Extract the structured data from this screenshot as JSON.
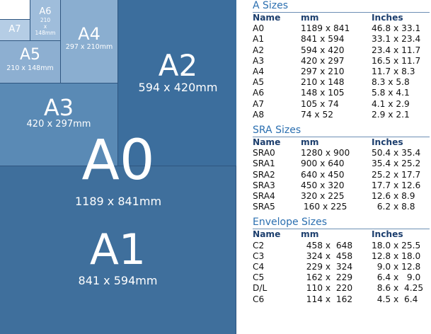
{
  "diagram": {
    "blocks": [
      {
        "id": "a0",
        "name": "A0",
        "dims": "1189 x 841mm"
      },
      {
        "id": "a1",
        "name": "A1",
        "dims": "841 x 594mm"
      },
      {
        "id": "a2",
        "name": "A2",
        "dims": "594 x 420mm"
      },
      {
        "id": "a3",
        "name": "A3",
        "dims": "420 x 297mm"
      },
      {
        "id": "a4",
        "name": "A4",
        "dims": "297 x 210mm"
      },
      {
        "id": "a5",
        "name": "A5",
        "dims": "210 x 148mm"
      },
      {
        "id": "a6",
        "name": "A6",
        "dims_lines": [
          "210",
          "x",
          "148mm"
        ]
      },
      {
        "id": "a7",
        "name": "A7"
      },
      {
        "id": "a8"
      }
    ],
    "colors": {
      "a0": "#3f6f9c",
      "a1": "#3f6f9c",
      "a2": "#3c6e9d",
      "a3": "#5a8ab5",
      "a4": "#8aaed0",
      "a5": "#8dafd1",
      "a6": "#9fbddb",
      "a7": "#b5cde5",
      "a8": "#ffffff",
      "border": "#2f5680"
    }
  },
  "tables": [
    {
      "title": "A Sizes",
      "headers": [
        "Name",
        "mm",
        "Inches"
      ],
      "rows": [
        [
          "A0",
          "1189 x 841",
          "46.8 x 33.1"
        ],
        [
          "A1",
          "841 x 594",
          "33.1 x 23.4"
        ],
        [
          "A2",
          "594 x 420",
          "23.4 x 11.7"
        ],
        [
          "A3",
          "420 x 297",
          "16.5 x 11.7"
        ],
        [
          "A4",
          "297 x 210",
          "11.7 x 8.3"
        ],
        [
          "A5",
          "210 x 148",
          "8.3 x 5.8"
        ],
        [
          "A6",
          "148 x 105",
          "5.8 x 4.1"
        ],
        [
          "A7",
          "105 x 74",
          "4.1 x 2.9"
        ],
        [
          "A8",
          "74 x 52",
          "2.9 x 2.1"
        ]
      ]
    },
    {
      "title": "SRA Sizes",
      "headers": [
        "Name",
        "mm",
        "Inches"
      ],
      "rows": [
        [
          "SRA0",
          "1280 x 900",
          "50.4 x 35.4"
        ],
        [
          "SRA1",
          "900 x 640",
          "35.4 x 25.2"
        ],
        [
          "SRA2",
          "640 x 450",
          "25.2 x 17.7"
        ],
        [
          "SRA3",
          "450 x 320",
          "17.7 x 12.6"
        ],
        [
          "SRA4",
          "320 x 225",
          "12.6 x 8.9"
        ],
        [
          "SRA5",
          " 160 x 225",
          "  6.2 x 8.8"
        ]
      ]
    },
    {
      "title": "Envelope Sizes",
      "headers": [
        "Name",
        "mm",
        "Inches"
      ],
      "rows": [
        [
          "C2",
          "  458 x  648",
          "18.0 x 25.5"
        ],
        [
          "C3",
          "  324 x  458",
          "12.8 x 18.0"
        ],
        [
          "C4",
          "  229 x  324",
          "  9.0 x 12.8"
        ],
        [
          "C5",
          "  162 x  229",
          "  6.4 x   9.0"
        ],
        [
          "D/L",
          "  110 x  220",
          "  8.6 x  4.25"
        ],
        [
          "C6",
          "  114 x  162",
          "  4.5 x  6.4"
        ]
      ]
    }
  ]
}
